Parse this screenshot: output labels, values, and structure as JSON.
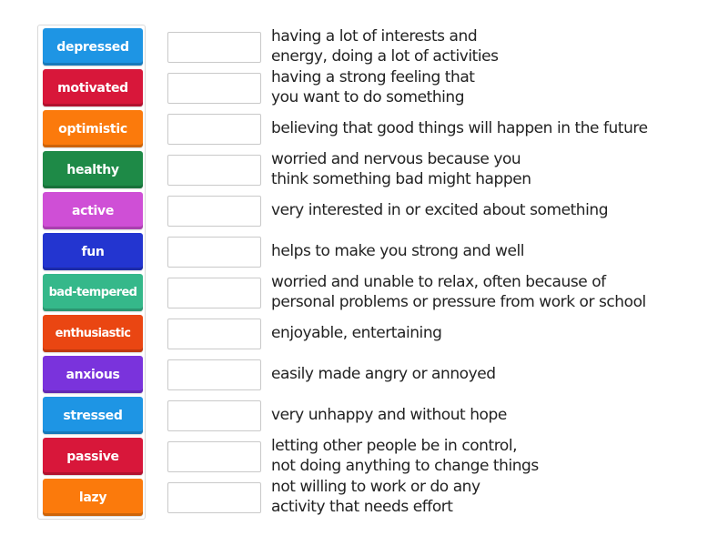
{
  "activity": {
    "type": "match-up",
    "words": [
      {
        "label": "depressed",
        "color": "#1e95e4"
      },
      {
        "label": "motivated",
        "color": "#d8173a"
      },
      {
        "label": "optimistic",
        "color": "#fb7a0c"
      },
      {
        "label": "healthy",
        "color": "#1e8a47"
      },
      {
        "label": "active",
        "color": "#cf4fd6"
      },
      {
        "label": "fun",
        "color": "#2335d0"
      },
      {
        "label": "bad-tempered",
        "color": "#35b88a"
      },
      {
        "label": "enthusiastic",
        "color": "#ea4612"
      },
      {
        "label": "anxious",
        "color": "#7a33dc"
      },
      {
        "label": "stressed",
        "color": "#1e95e4"
      },
      {
        "label": "passive",
        "color": "#d8173a"
      },
      {
        "label": "lazy",
        "color": "#fb7a0c"
      }
    ],
    "answer_slots": [
      {
        "value": ""
      },
      {
        "value": ""
      },
      {
        "value": ""
      },
      {
        "value": ""
      },
      {
        "value": ""
      },
      {
        "value": ""
      },
      {
        "value": ""
      },
      {
        "value": ""
      },
      {
        "value": ""
      },
      {
        "value": ""
      },
      {
        "value": ""
      },
      {
        "value": ""
      }
    ],
    "definitions": [
      "having a lot of interests and\nenergy, doing a lot of activities",
      "having a strong feeling that\nyou want to do something",
      "believing that good things will happen in the future",
      "worried and nervous because you\nthink something bad might happen",
      "very interested in or excited about something",
      "helps to make you strong and well",
      "worried and unable to relax, often because of\npersonal problems or pressure from work or school",
      "enjoyable, entertaining",
      "easily made angry or annoyed",
      "very unhappy and without hope",
      "letting other people be in control,\nnot doing anything to change things",
      "not willing to work or do any\nactivity that needs effort"
    ]
  }
}
